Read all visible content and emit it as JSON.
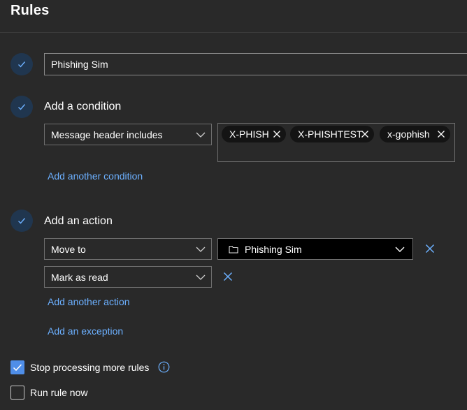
{
  "header": {
    "title": "Rules"
  },
  "rule_name": {
    "value": "Phishing Sim"
  },
  "condition": {
    "label": "Add a condition",
    "field": "Message header includes",
    "tags": [
      "X-PHISH",
      "X-PHISHTEST",
      "x-gophish"
    ],
    "add_link": "Add another condition"
  },
  "action": {
    "label": "Add an action",
    "first_action": "Move to",
    "folder": "Phishing Sim",
    "second_action": "Mark as read",
    "add_link": "Add another action",
    "exception_link": "Add an exception"
  },
  "options": {
    "stop_processing": {
      "label": "Stop processing more rules",
      "checked": true
    },
    "run_now": {
      "label": "Run rule now",
      "checked": false
    }
  },
  "colors": {
    "accent": "#4f8ee8",
    "link": "#6cb0ff",
    "background": "#292929"
  }
}
